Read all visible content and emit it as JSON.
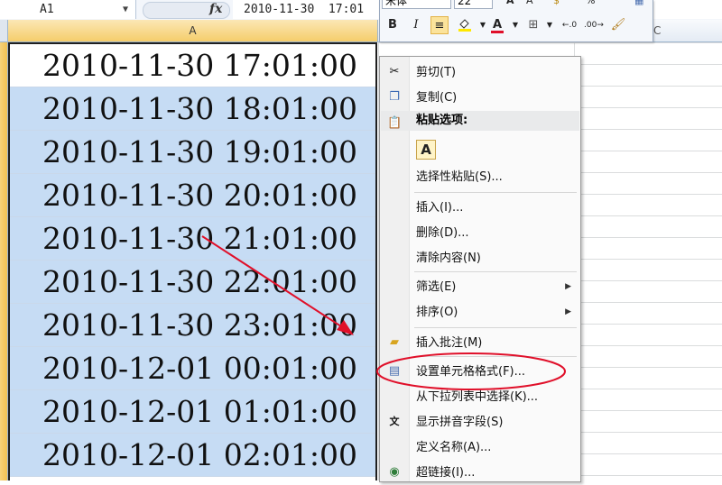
{
  "formula_bar": {
    "name_box": "A1",
    "fx": "fx",
    "formula": "2010-11-30  17:01"
  },
  "columns": {
    "a": "A",
    "c": "C"
  },
  "cells": [
    "2010-11-30 17:01:00",
    "2010-11-30 18:01:00",
    "2010-11-30 19:01:00",
    "2010-11-30 20:01:00",
    "2010-11-30 21:01:00",
    "2010-11-30 22:01:00",
    "2010-11-30 23:01:00",
    "2010-12-01 00:01:00",
    "2010-12-01 01:01:00",
    "2010-12-01 02:01:00"
  ],
  "mini_toolbar": {
    "font": "宋体",
    "size": "22",
    "bold": "B",
    "italic": "I",
    "font_color": "A"
  },
  "context_menu": {
    "cut": "剪切(T)",
    "copy": "复制(C)",
    "paste_options_header": "粘贴选项:",
    "paste_a": "A",
    "paste_special": "选择性粘贴(S)...",
    "insert": "插入(I)...",
    "delete": "删除(D)...",
    "clear_contents": "清除内容(N)",
    "filter": "筛选(E)",
    "sort": "排序(O)",
    "insert_comment": "插入批注(M)",
    "format_cells": "设置单元格格式(F)...",
    "pick_from_list": "从下拉列表中选择(K)...",
    "show_phonetic": "显示拼音字段(S)",
    "define_name": "定义名称(A)...",
    "hyperlink": "超链接(I)..."
  },
  "colors": {
    "selection": "#c6dcf4",
    "annotation_red": "#e0102a",
    "header_highlight": "#f5cd6b"
  }
}
